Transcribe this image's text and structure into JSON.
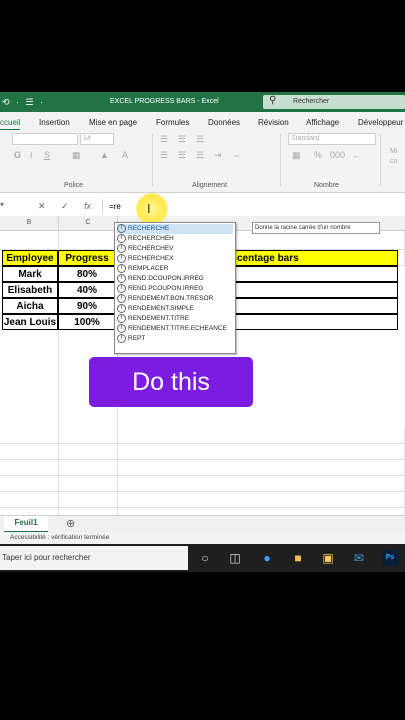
{
  "titlebar": {
    "qat": "⟲ · ☰ ·",
    "title": "EXCEL PROGRESS BARS  -  Excel",
    "search_placeholder": "Rechercher"
  },
  "ribbon_tabs": [
    "ccueil",
    "Insertion",
    "Mise en page",
    "Formules",
    "Données",
    "Révision",
    "Affichage",
    "Développeur"
  ],
  "ribbon": {
    "font_size": "14",
    "number_format": "Standard",
    "groups": [
      "Police",
      "Alignement",
      "Nombre"
    ],
    "more_label_1": "Mi",
    "more_label_2": "co"
  },
  "formula_bar": {
    "cancel": "✕",
    "enter": "✓",
    "fx": "fx",
    "content": "=re"
  },
  "columns": [
    "B",
    "C"
  ],
  "table": {
    "headers": [
      "Employee",
      "Progress",
      "centage bars"
    ],
    "rows": [
      {
        "name": "Mark",
        "progress": "80%"
      },
      {
        "name": "Elisabeth",
        "progress": "40%"
      },
      {
        "name": "Aicha",
        "progress": "90%"
      },
      {
        "name": "Jean Louis",
        "progress": "100%"
      }
    ]
  },
  "autocomplete": {
    "items": [
      "RECHERCHE",
      "RECHERCHEH",
      "RECHERCHEV",
      "RECHERCHEX",
      "REMPLACER",
      "REND.DCOUPON.IRREG",
      "REND.PCOUPON.IRREG",
      "RENDEMENT.BON.TRESOR",
      "RENDEMENT.SIMPLE",
      "RENDEMENT.TITRE",
      "RENDEMENT.TITRE.ECHEANCE",
      "REPT"
    ],
    "selected_index": 0,
    "tooltip": "Donne la racine carrée d'un nombre"
  },
  "overlay_button": "Do this",
  "sheet_tab": "Feuil1",
  "status": "Accessibilité : vérification terminée",
  "taskbar": {
    "search_placeholder": "Taper ici pour rechercher"
  },
  "colors": {
    "excel_green": "#217346",
    "header_yellow": "#ffff00",
    "button_purple": "#7a1de0"
  }
}
